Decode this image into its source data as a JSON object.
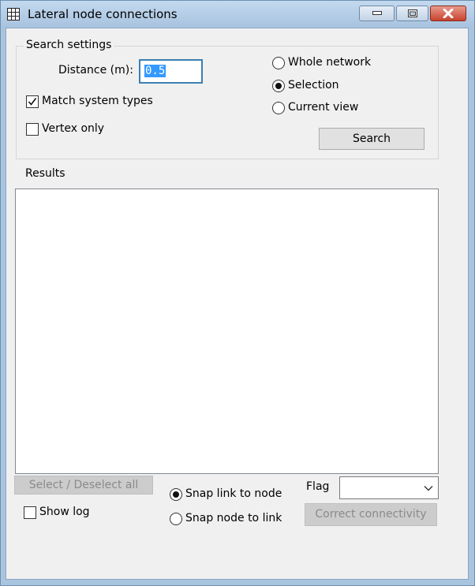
{
  "window": {
    "title": "Lateral node connections",
    "title_icon": "table-grid-icon",
    "controls": [
      "minimize-icon",
      "maximize-icon",
      "close-icon"
    ]
  },
  "search_settings": {
    "group_label": "Search settings",
    "distance_label": "Distance (m):",
    "distance_value": "0.5",
    "match_system_types": {
      "label": "Match system types",
      "checked": true
    },
    "vertex_only": {
      "label": "Vertex only",
      "checked": false
    },
    "scope": {
      "options": [
        "Whole network",
        "Selection",
        "Current view"
      ],
      "selected": "Selection"
    },
    "search_button": "Search"
  },
  "results": {
    "label": "Results"
  },
  "bottom": {
    "select_deselect_button": "Select / Deselect all",
    "show_log": {
      "label": "Show log",
      "checked": false
    },
    "snap": {
      "options": [
        "Snap link to node",
        "Snap node to link"
      ],
      "selected": "Snap link to node"
    },
    "flag_label": "Flag",
    "flag_value": "",
    "correct_button": "Correct connectivity"
  },
  "colors": {
    "frame": "#a9c4df",
    "client_bg": "#f0f0f0",
    "selection_highlight": "#3399ff",
    "focus_border": "#3c7fb1",
    "close_button": "#c7422e"
  }
}
